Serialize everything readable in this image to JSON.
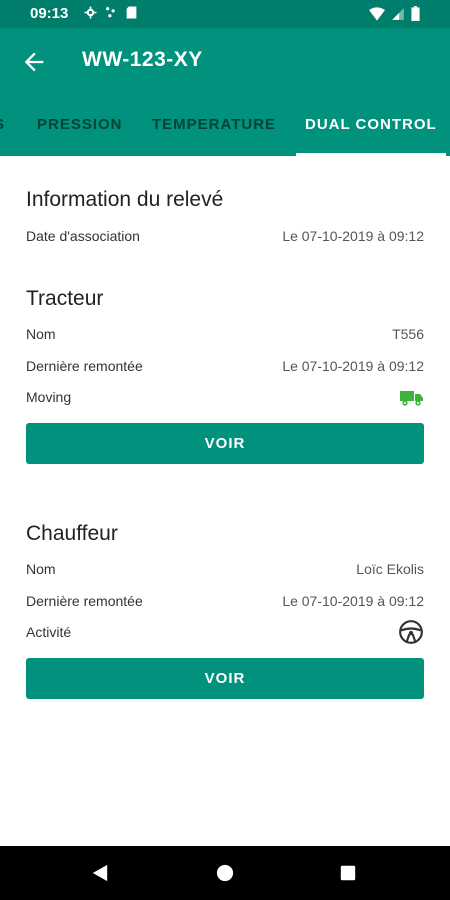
{
  "status_bar": {
    "time": "09:13"
  },
  "app_bar": {
    "title": "WW-123-XY"
  },
  "tabs": [
    {
      "label": "S"
    },
    {
      "label": "PRESSION"
    },
    {
      "label": "TEMPERATURE"
    },
    {
      "label": "DUAL CONTROL"
    }
  ],
  "info": {
    "title": "Information du relevé",
    "date_label": "Date d'association",
    "date_value": "Le 07-10-2019 à 09:12"
  },
  "tracteur": {
    "title": "Tracteur",
    "nom_label": "Nom",
    "nom_value": "T556",
    "derniere_label": "Dernière remontée",
    "derniere_value": "Le 07-10-2019 à 09:12",
    "moving_label": "Moving",
    "status_icon": "truck-icon",
    "button_label": "VOIR"
  },
  "chauffeur": {
    "title": "Chauffeur",
    "nom_label": "Nom",
    "nom_value": "Loïc Ekolis",
    "derniere_label": "Dernière remontée",
    "derniere_value": "Le 07-10-2019 à 09:12",
    "activite_label": "Activité",
    "activite_icon": "steering-wheel-icon",
    "button_label": "VOIR"
  },
  "colors": {
    "primary": "#00927c",
    "primary_dark": "#007d6b",
    "moving_green": "#3cb43c"
  }
}
